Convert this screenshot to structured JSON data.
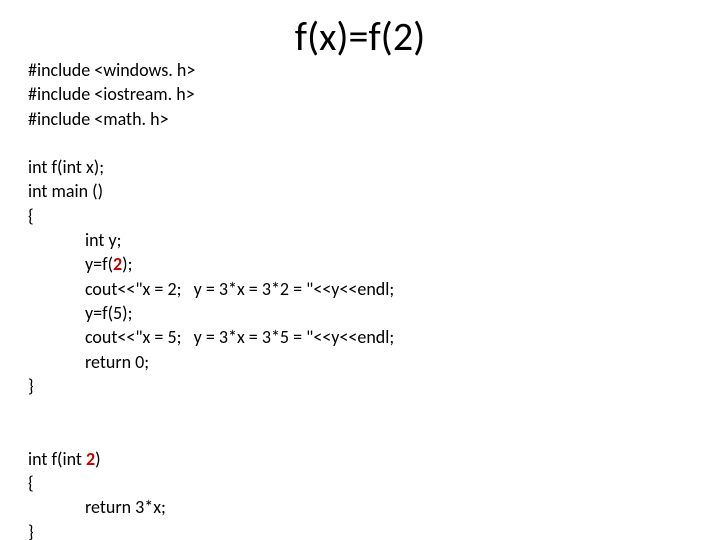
{
  "title": "f(x)=f(2)",
  "code": {
    "inc1": "#include <windows. h>",
    "inc2": "#include <iostream. h>",
    "inc3": "#include <math. h>",
    "blank1": "",
    "l1": "int f(int x);",
    "l2": "int main ()",
    "l3": "{",
    "l4": "              int y;",
    "l5a": "              y=f(",
    "l5b": "2",
    "l5c": ");",
    "l6": "              cout<<\"x = 2;   y = 3*x = 3*2 = \"<<y<<endl;",
    "l7": "              y=f(5);",
    "l8": "              cout<<\"x = 5;   y = 3*x = 3*5 = \"<<y<<endl;",
    "l9": "              return 0;",
    "l10": "}",
    "blank2": "",
    "blank3": "",
    "l11a": "int f(int ",
    "l11b": "2",
    "l11c": ")",
    "l12": "{",
    "l13": "              return 3*x;",
    "l14": "}"
  }
}
